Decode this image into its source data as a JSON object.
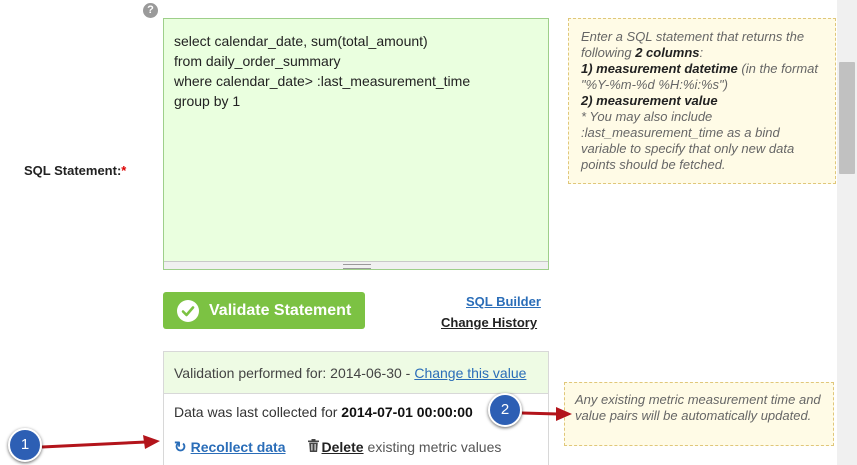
{
  "form": {
    "help_icon": "?",
    "sql_label": "SQL Statement:",
    "required_marker": "*",
    "sql_lines": "select calendar_date, sum(total_amount)\nfrom daily_order_summary\nwhere calendar_date> :last_measurement_time\ngroup by 1"
  },
  "hint": {
    "line1": "Enter a SQL statement that returns the following ",
    "cols": "2 columns",
    "colon": ":",
    "item1_num": "1) ",
    "item1_bold": "measurement datetime",
    "item1_rest": " (in the format \"%Y-%m-%d %H:%i:%s\")",
    "item2_num": "2) ",
    "item2_bold": "measurement value",
    "note": "* You may also include :last_measurement_time as a bind variable to specify that only new data points should be fetched."
  },
  "toolbar": {
    "validate_label": "Validate Statement",
    "sql_builder_label": "SQL Builder",
    "change_history_label": "Change History"
  },
  "validation": {
    "performed_label": "Validation performed for: 2014-06-30 -",
    "change_value_label": "Change this value",
    "last_collected_label": "Data was last collected for ",
    "last_collected_value": "2014-07-01 00:00:00",
    "recollect_label": "Recollect data",
    "delete_label": "Delete",
    "delete_rest": "existing metric values"
  },
  "hint2": {
    "text": "Any existing metric measurement time and value pairs will be automatically updated."
  },
  "callouts": {
    "one": "1",
    "two": "2"
  },
  "colors": {
    "accent_green": "#7cc243",
    "link_blue": "#2a6db8",
    "callout_blue": "#2d5fb4",
    "arrow_red": "#b3141b"
  }
}
